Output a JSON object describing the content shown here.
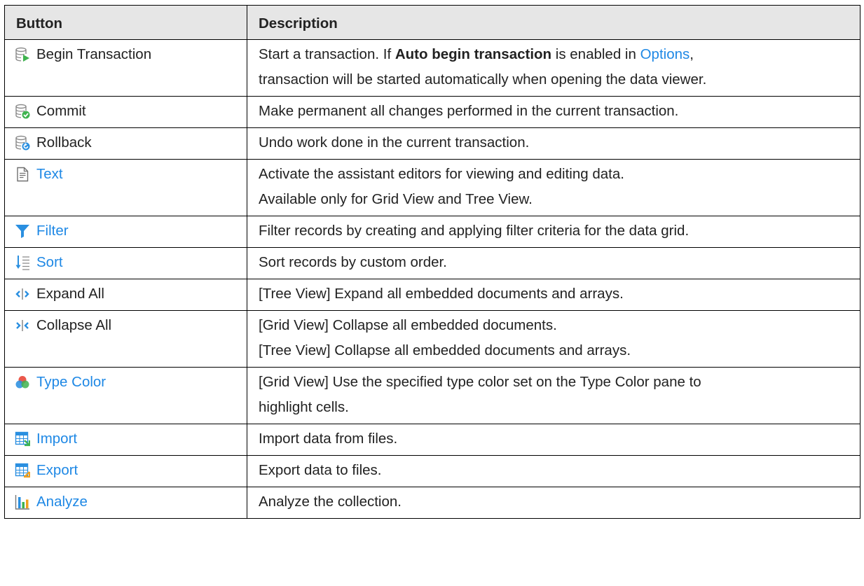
{
  "header": {
    "col1": "Button",
    "col2": "Description"
  },
  "colors": {
    "link": "#1e88e5",
    "header_bg": "#e6e6e6",
    "border": "#000000"
  },
  "rows": [
    {
      "icon": "begin-transaction-icon",
      "label": "Begin Transaction",
      "is_link": false,
      "description": {
        "pre": "Start a transaction. If ",
        "bold": "Auto begin transaction",
        "mid": " is enabled in ",
        "link": "Options",
        "post": ",",
        "line2": "transaction will be started automatically when opening the data viewer."
      }
    },
    {
      "icon": "commit-icon",
      "label": "Commit",
      "is_link": false,
      "description": [
        "Make permanent all changes performed in the current transaction."
      ]
    },
    {
      "icon": "rollback-icon",
      "label": "Rollback",
      "is_link": false,
      "description": [
        "Undo work done in the current transaction."
      ]
    },
    {
      "icon": "text-icon",
      "label": "Text",
      "is_link": true,
      "description": [
        "Activate the assistant editors for viewing and editing data.",
        "Available only for Grid View and Tree View."
      ]
    },
    {
      "icon": "filter-icon",
      "label": "Filter",
      "is_link": true,
      "description": [
        "Filter records by creating and applying filter criteria for the data grid."
      ]
    },
    {
      "icon": "sort-icon",
      "label": "Sort",
      "is_link": true,
      "description": [
        "Sort records by custom order."
      ]
    },
    {
      "icon": "expand-all-icon",
      "label": "Expand All",
      "is_link": false,
      "description": [
        "[Tree View] Expand all embedded documents and arrays."
      ]
    },
    {
      "icon": "collapse-all-icon",
      "label": "Collapse All",
      "is_link": false,
      "description": [
        "[Grid View] Collapse all embedded documents.",
        "[Tree View] Collapse all embedded documents and arrays."
      ]
    },
    {
      "icon": "type-color-icon",
      "label": "Type Color",
      "is_link": true,
      "description": [
        "[Grid View] Use the specified type color set on the Type Color pane to",
        "highlight cells."
      ]
    },
    {
      "icon": "import-icon",
      "label": "Import",
      "is_link": true,
      "description": [
        "Import data from files."
      ]
    },
    {
      "icon": "export-icon",
      "label": "Export",
      "is_link": true,
      "description": [
        "Export data to files."
      ]
    },
    {
      "icon": "analyze-icon",
      "label": "Analyze",
      "is_link": true,
      "description": [
        "Analyze the collection."
      ]
    }
  ]
}
